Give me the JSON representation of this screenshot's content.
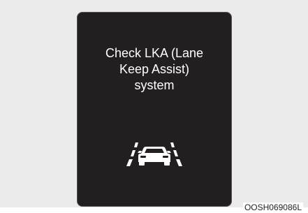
{
  "warning": {
    "message_lines": [
      "Check LKA (Lane",
      "Keep Assist)",
      "system"
    ],
    "icon": "lane-keep-assist-icon"
  },
  "image_code": "OOSH069086L",
  "colors": {
    "background": "#ebebeb",
    "screen": "#231f20",
    "text": "#ffffff"
  }
}
